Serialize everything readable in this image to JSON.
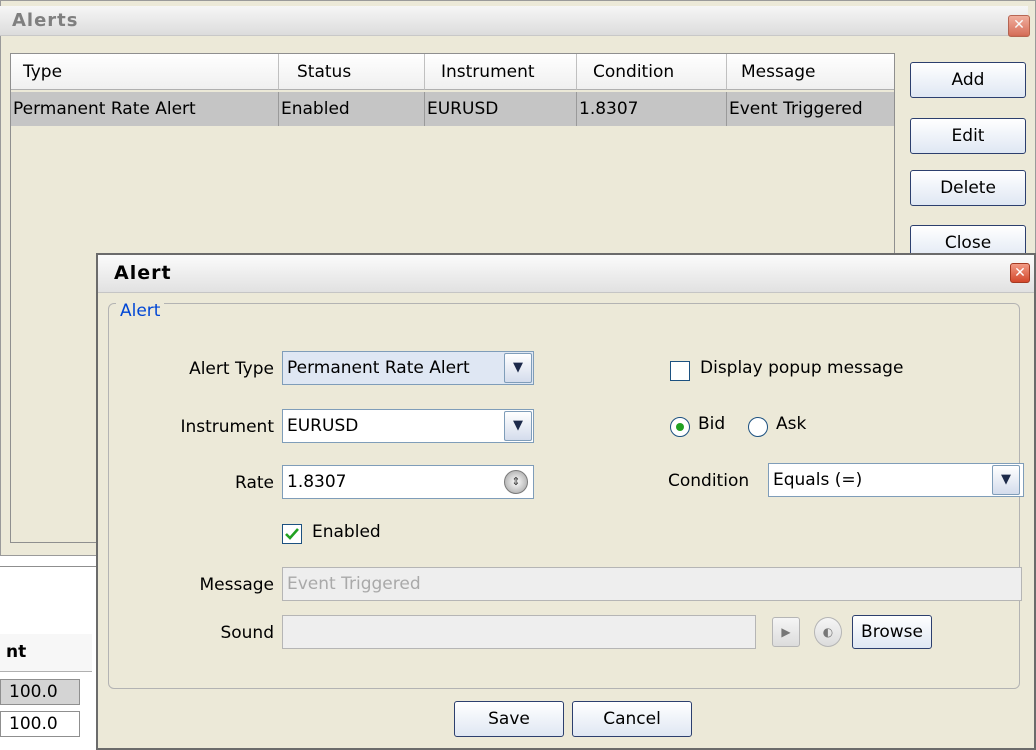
{
  "alerts_window": {
    "title": "Alerts",
    "close_symbol": "✕",
    "table": {
      "columns": [
        "Type",
        "Status",
        "Instrument",
        "Condition",
        "Message"
      ],
      "rows": [
        [
          "Permanent Rate Alert",
          "Enabled",
          "EURUSD",
          "1.8307",
          "Event Triggered"
        ]
      ]
    },
    "buttons": {
      "add": "Add",
      "edit": "Edit",
      "delete": "Delete",
      "close": "Close"
    }
  },
  "background_table": {
    "header": "nt",
    "rows": [
      "100.0",
      "100.0"
    ]
  },
  "alert_dialog": {
    "title": "Alert",
    "close_symbol": "✕",
    "group_label": "Alert",
    "alert_type": {
      "label": "Alert Type",
      "value": "Permanent Rate Alert"
    },
    "instrument": {
      "label": "Instrument",
      "value": "EURUSD"
    },
    "rate": {
      "label": "Rate",
      "value": "1.8307"
    },
    "enabled": {
      "label": "Enabled",
      "checked": true
    },
    "display_popup": {
      "label": "Display popup message",
      "checked": false
    },
    "price_side": {
      "bid_label": "Bid",
      "ask_label": "Ask",
      "selected": "Bid"
    },
    "condition": {
      "label": "Condition",
      "value": "Equals (=)"
    },
    "message": {
      "label": "Message",
      "placeholder": "Event Triggered"
    },
    "sound": {
      "label": "Sound",
      "value": "",
      "browse_label": "Browse"
    },
    "buttons": {
      "save": "Save",
      "cancel": "Cancel"
    }
  },
  "icons": {
    "dropdown": "chevron-down-icon",
    "spinner": "spinner-icon",
    "play": "play-icon",
    "speaker": "speaker-icon",
    "close": "close-icon"
  },
  "colors": {
    "accent": "#0046d5",
    "close_red": "#d3482c",
    "window_bg": "#ece9d8"
  }
}
